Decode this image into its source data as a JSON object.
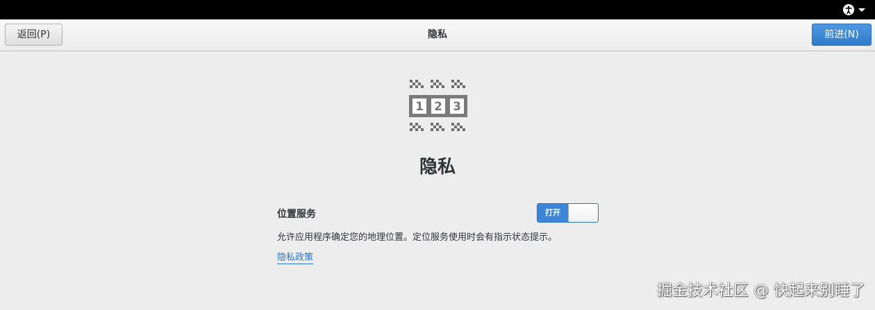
{
  "header": {
    "back_label": "返回(P)",
    "title": "隐私",
    "next_label": "前进(N)"
  },
  "hero": {
    "icon": "privacy-numbers-icon",
    "digits": [
      "1",
      "2",
      "3"
    ]
  },
  "main": {
    "title": "隐私",
    "location_service": {
      "label": "位置服务",
      "toggle_state": "打开",
      "description": "允许应用程序确定您的地理位置。定位服务使用时会有指示状态提示。"
    },
    "policy_link": "隐私政策"
  },
  "watermark": "掘金技术社区 @ 快起来别睡了",
  "colors": {
    "accent": "#3d85d6",
    "link": "#2a76c6",
    "topbar": "#000000",
    "background": "#ededed"
  }
}
